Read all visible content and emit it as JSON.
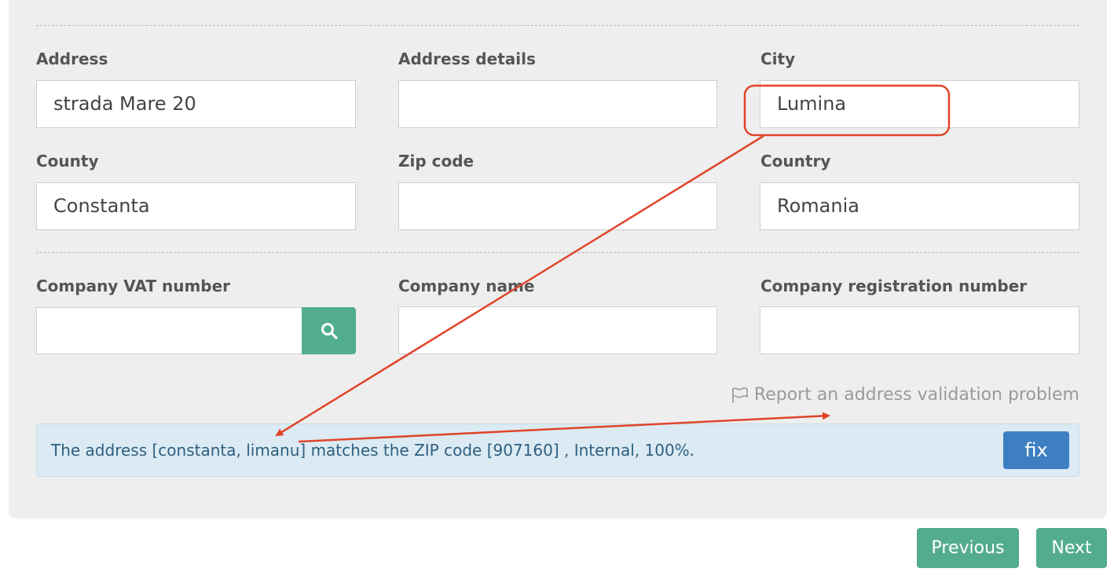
{
  "address_section": {
    "address": {
      "label": "Address",
      "value": "strada Mare 20"
    },
    "address_details": {
      "label": "Address details",
      "value": ""
    },
    "city": {
      "label": "City",
      "value": "Lumina"
    },
    "county": {
      "label": "County",
      "value": "Constanta"
    },
    "zip": {
      "label": "Zip code",
      "value": ""
    },
    "country": {
      "label": "Country",
      "value": "Romania"
    }
  },
  "company_section": {
    "vat": {
      "label": "Company VAT number",
      "value": "",
      "search_icon": "search-icon"
    },
    "name": {
      "label": "Company name",
      "value": ""
    },
    "registration": {
      "label": "Company registration number",
      "value": ""
    }
  },
  "report_link": {
    "icon": "flag-icon",
    "text": "Report an address validation problem"
  },
  "alert": {
    "text": "The address [constanta, limanu] matches the ZIP code [907160] , Internal, 100%.",
    "fix_label": "fix"
  },
  "navigation": {
    "previous_label": "Previous",
    "next_label": "Next"
  },
  "colors": {
    "accent_green": "#52ad8f",
    "fix_blue": "#3d7fc1",
    "annotation_red": "#e0442a",
    "alert_bg": "#dbeaf3"
  }
}
